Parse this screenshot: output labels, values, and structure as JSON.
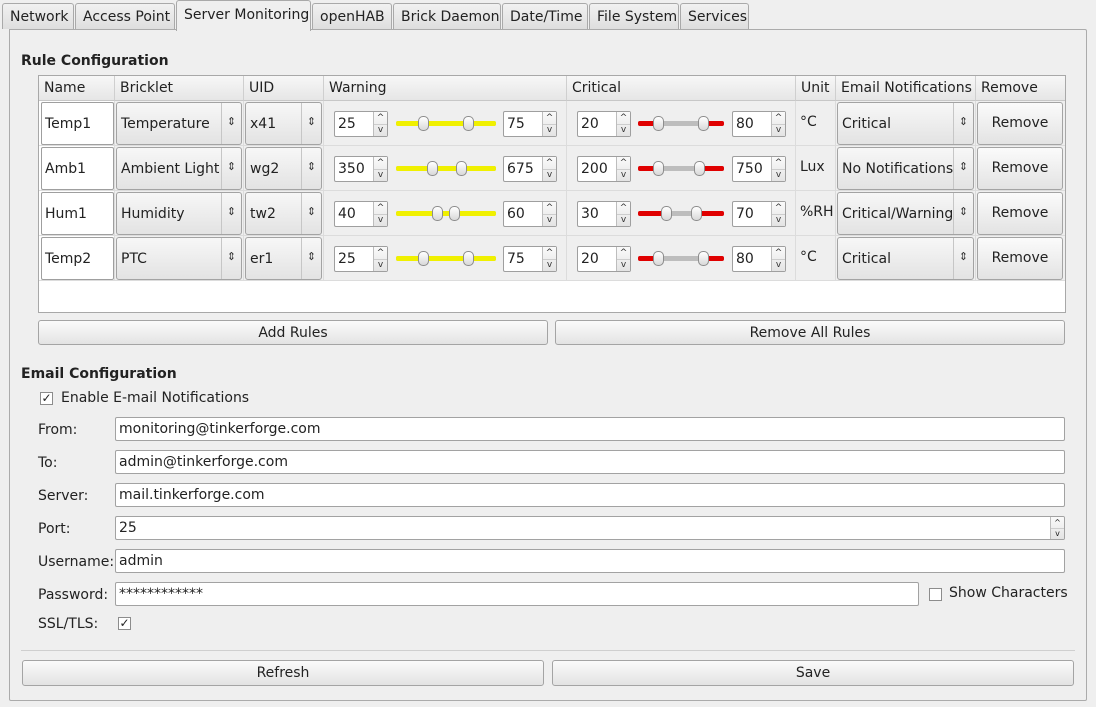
{
  "tabs": [
    "Network",
    "Access Point",
    "Server Monitoring",
    "openHAB",
    "Brick Daemon",
    "Date/Time",
    "File System",
    "Services"
  ],
  "active_tab": "Server Monitoring",
  "rule_config": {
    "title": "Rule Configuration",
    "headers": {
      "name": "Name",
      "bricklet": "Bricklet",
      "uid": "UID",
      "warning": "Warning",
      "critical": "Critical",
      "unit": "Unit",
      "email": "Email Notifications",
      "remove": "Remove"
    },
    "rows": [
      {
        "name": "Temp1",
        "bricklet": "Temperature",
        "uid": "x41",
        "warning_low": "25",
        "warning_high": "75",
        "critical_low": "20",
        "critical_high": "80",
        "unit": "°C",
        "email": "Critical",
        "remove": "Remove"
      },
      {
        "name": "Amb1",
        "bricklet": "Ambient Light",
        "uid": "wg2",
        "warning_low": "350",
        "warning_high": "675",
        "critical_low": "200",
        "critical_high": "750",
        "unit": "Lux",
        "email": "No Notifications",
        "remove": "Remove"
      },
      {
        "name": "Hum1",
        "bricklet": "Humidity",
        "uid": "tw2",
        "warning_low": "40",
        "warning_high": "60",
        "critical_low": "30",
        "critical_high": "70",
        "unit": "%RH",
        "email": "Critical/Warning",
        "remove": "Remove"
      },
      {
        "name": "Temp2",
        "bricklet": "PTC",
        "uid": "er1",
        "warning_low": "25",
        "warning_high": "75",
        "critical_low": "20",
        "critical_high": "80",
        "unit": "°C",
        "email": "Critical",
        "remove": "Remove"
      }
    ],
    "add_rules": "Add Rules",
    "remove_all": "Remove All Rules"
  },
  "email_config": {
    "title": "Email Configuration",
    "enable_label": "Enable E-mail Notifications",
    "enable_checked": true,
    "from_label": "From:",
    "from_value": "monitoring@tinkerforge.com",
    "to_label": "To:",
    "to_value": "admin@tinkerforge.com",
    "server_label": "Server:",
    "server_value": "mail.tinkerforge.com",
    "port_label": "Port:",
    "port_value": "25",
    "username_label": "Username:",
    "username_value": "admin",
    "password_label": "Password:",
    "password_value": "************",
    "show_chars_label": "Show Characters",
    "show_chars_checked": false,
    "ssl_label": "SSL/TLS:",
    "ssl_checked": true
  },
  "footer": {
    "refresh": "Refresh",
    "save": "Save"
  },
  "colors": {
    "warning_fill": "#f0f000",
    "critical_fill": "#e00000"
  },
  "icons": {
    "check": "checkmark-icon",
    "spin_up": "spin-up-icon",
    "spin_down": "spin-down-icon",
    "combo_arrow": "updown-arrow-icon"
  }
}
